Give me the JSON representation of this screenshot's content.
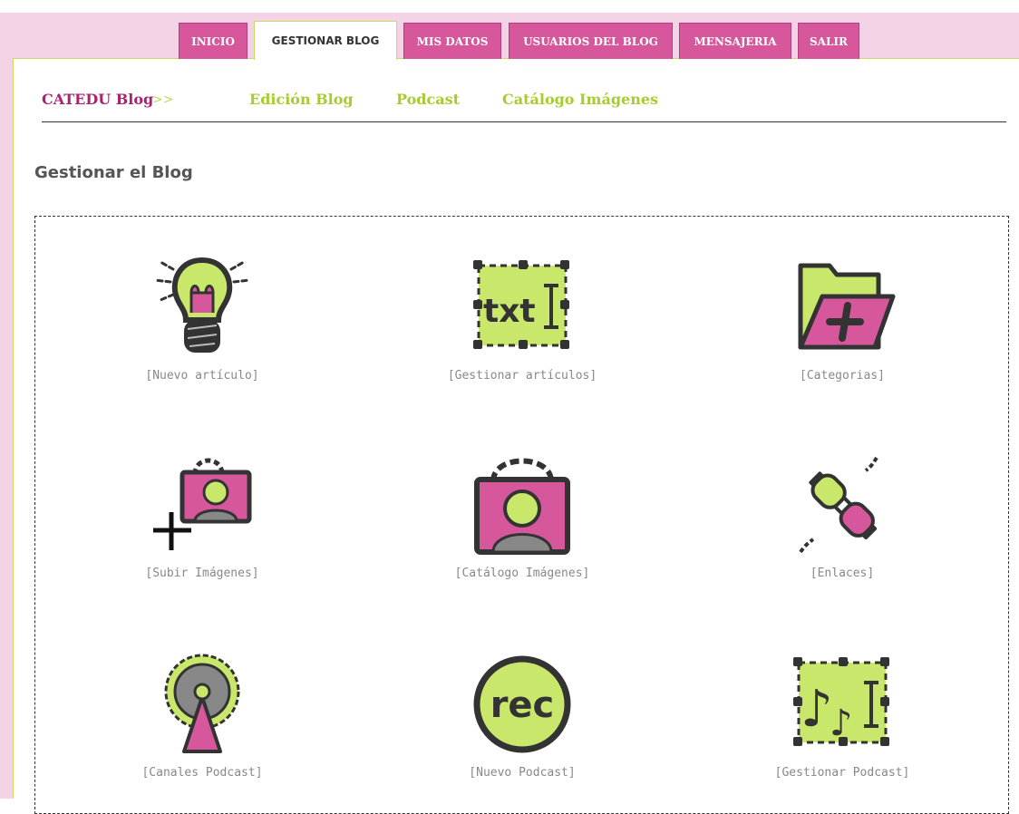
{
  "tabs": [
    {
      "label": "INICIO",
      "active": false
    },
    {
      "label": "GESTIONAR BLOG",
      "active": true
    },
    {
      "label": "MIS DATOS",
      "active": false
    },
    {
      "label": "USUARIOS DEL BLOG",
      "active": false
    },
    {
      "label": "MENSAJERIA",
      "active": false
    },
    {
      "label": "SALIR",
      "active": false
    }
  ],
  "subnav": {
    "crumb": "CATEDU Blog",
    "crumb_sep": ">>",
    "links": [
      "Edición Blog",
      "Podcast",
      "Catálogo Imágenes"
    ]
  },
  "page_title": "Gestionar el Blog",
  "items": [
    {
      "label": "[Nuevo artículo]",
      "icon": "lightbulb-icon"
    },
    {
      "label": "[Gestionar artículos]",
      "icon": "text-frame-icon"
    },
    {
      "label": "[Categorias]",
      "icon": "folder-plus-icon"
    },
    {
      "label": "[Subir Imágenes]",
      "icon": "upload-picture-icon"
    },
    {
      "label": "[Catálogo Imágenes]",
      "icon": "picture-frame-icon"
    },
    {
      "label": "[Enlaces]",
      "icon": "plug-link-icon"
    },
    {
      "label": "[Canales Podcast]",
      "icon": "broadcast-antenna-icon"
    },
    {
      "label": "[Nuevo Podcast]",
      "icon": "rec-icon"
    },
    {
      "label": "[Gestionar Podcast]",
      "icon": "music-frame-icon"
    }
  ],
  "colors": {
    "pink": "#d7579c",
    "lime": "#c9e86b",
    "dark": "#333333",
    "band": "#f5d3e6"
  }
}
